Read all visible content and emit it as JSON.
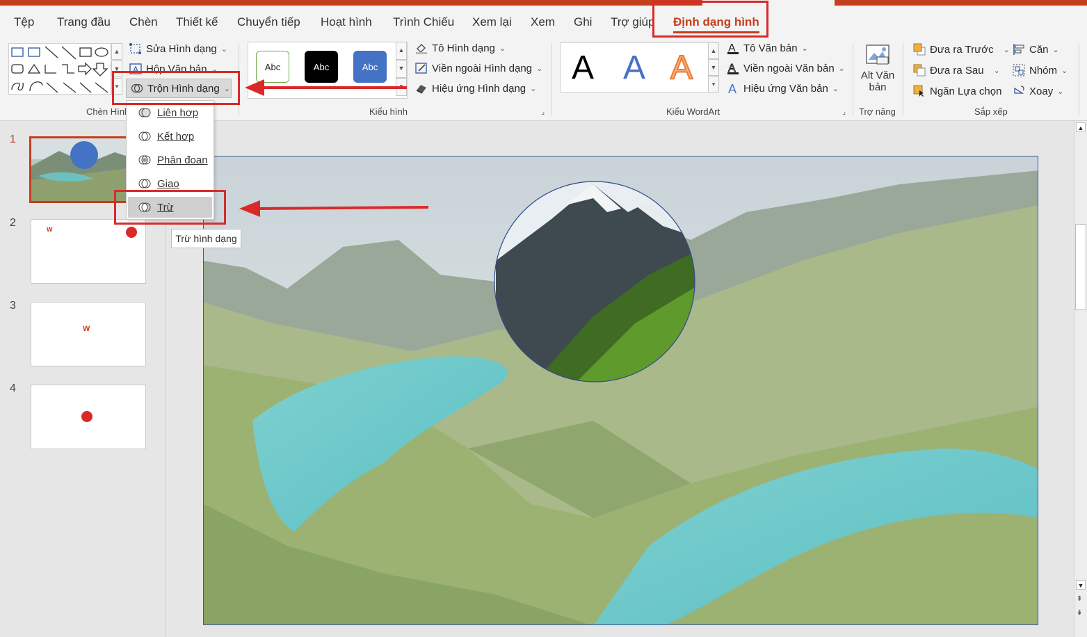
{
  "tabs": [
    {
      "label": "Tệp"
    },
    {
      "label": "Trang đầu"
    },
    {
      "label": "Chèn"
    },
    {
      "label": "Thiết kế"
    },
    {
      "label": "Chuyển tiếp"
    },
    {
      "label": "Hoạt hình"
    },
    {
      "label": "Trình Chiếu"
    },
    {
      "label": "Xem lại"
    },
    {
      "label": "Xem"
    },
    {
      "label": "Ghi"
    },
    {
      "label": "Trợ giúp"
    },
    {
      "label": "Định dạng hình"
    }
  ],
  "insert_shapes": {
    "edit_shape": "Sửa Hình dạng",
    "text_box": "Hộp Văn bản",
    "merge_shapes": "Trộn Hình dạng",
    "group_label": "Chèn Hình"
  },
  "shape_styles": {
    "abc1": "Abc",
    "abc2": "Abc",
    "abc3": "Abc",
    "fill": "Tô Hình dạng",
    "outline": "Viền ngoài Hình dạng",
    "effects": "Hiệu ứng Hình dạng",
    "group_label": "Kiểu hình"
  },
  "wordart": {
    "letter1": "A",
    "letter2": "A",
    "letter3": "A",
    "text_fill": "Tô Văn bản",
    "text_outline": "Viền ngoài Văn bản",
    "text_effects": "Hiệu ứng Văn bản",
    "group_label": "Kiểu WordArt"
  },
  "accessibility": {
    "alt_text_line1": "Alt Văn",
    "alt_text_line2": "bản",
    "group_label": "Trợ năng"
  },
  "arrange": {
    "bring_forward": "Đưa ra Trước",
    "send_backward": "Đưa ra Sau",
    "selection_pane": "Ngăn Lựa chọn",
    "align": "Căn",
    "group": "Nhóm",
    "rotate": "Xoay",
    "group_label": "Sắp xếp"
  },
  "merge_menu": {
    "items": [
      {
        "label": "Liên hợp"
      },
      {
        "label": "Kết hợp"
      },
      {
        "label": "Phân đoạn"
      },
      {
        "label": "Giao"
      },
      {
        "label": "Trừ"
      }
    ]
  },
  "tooltip": "Trừ hình dạng",
  "slides": [
    {
      "number": "1"
    },
    {
      "number": "2"
    },
    {
      "number": "3"
    },
    {
      "number": "4"
    }
  ],
  "colors": {
    "accent": "#c43e1c",
    "annotation_red": "#d92a2a",
    "circle_blue": "#4472c4"
  },
  "icons": [
    "shape-edit-icon",
    "text-box-icon",
    "merge-shapes-icon",
    "shape-fill-icon",
    "shape-outline-icon",
    "shape-effects-icon",
    "text-fill-icon",
    "text-outline-icon",
    "text-effects-icon",
    "alt-text-icon",
    "bring-forward-icon",
    "send-backward-icon",
    "selection-pane-icon",
    "align-icon",
    "group-icon",
    "rotate-icon",
    "dialog-launcher-icon"
  ]
}
